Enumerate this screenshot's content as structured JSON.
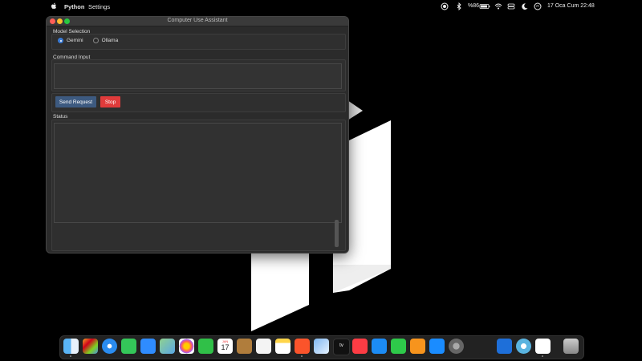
{
  "menubar": {
    "app_name": "Python",
    "settings_label": "Settings",
    "battery_pct": "%86",
    "datetime": "17 Oca Cum  22:48"
  },
  "window": {
    "title": "Computer Use Assistant",
    "model_section_label": "Model Selection",
    "model_options": [
      {
        "label": "Gemini",
        "selected": true
      },
      {
        "label": "Ollama",
        "selected": false
      }
    ],
    "command_section_label": "Command Input",
    "command_value": "",
    "send_button_label": "Send Request",
    "stop_button_label": "Stop",
    "status_section_label": "Status",
    "status_text": ""
  },
  "colors": {
    "send_button": "#3d5a80",
    "stop_button": "#e03b3b",
    "radio_selected": "#3a7bd5"
  },
  "dock": {
    "calendar_month": "JAN",
    "calendar_day": "17",
    "tv_label": "tv",
    "apps": [
      "finder-icon",
      "launchpad-icon",
      "safari-icon",
      "messages-icon",
      "mail-icon",
      "maps-icon",
      "photos-icon",
      "facetime-icon",
      "calendar-icon",
      "keynote-desk-icon",
      "reminders-icon",
      "notes-icon",
      "brave-icon",
      "preview-icon",
      "appletv-icon",
      "music-icon",
      "keynote-icon",
      "numbers-icon",
      "pages-icon",
      "appstore-icon",
      "systemsettings-icon",
      "unity-icon",
      "finder-window-icon",
      "quicktime-icon",
      "python-launcher-icon",
      "trash-icon"
    ]
  }
}
